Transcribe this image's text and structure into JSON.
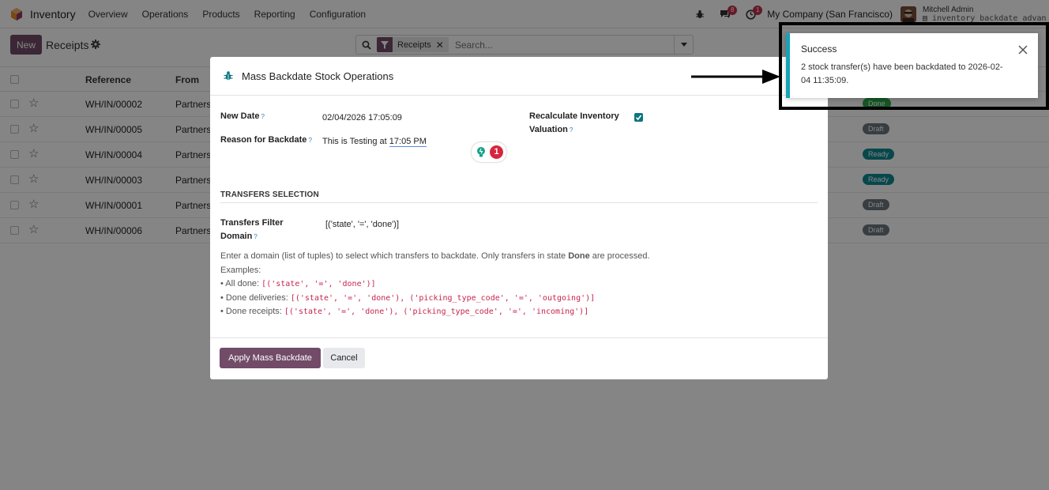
{
  "navbar": {
    "app_name": "Inventory",
    "menu": [
      "Overview",
      "Operations",
      "Products",
      "Reporting",
      "Configuration"
    ],
    "messages_count": "8",
    "activities_count": "1",
    "company": "My Company (San Francisco)",
    "user_name": "Mitchell Admin",
    "database": "inventory_backdate_advan"
  },
  "control": {
    "new_label": "New",
    "page_title": "Receipts",
    "facet_label": "Receipts",
    "facet_remove": "✕",
    "search_placeholder": "Search..."
  },
  "list": {
    "columns": [
      "Reference",
      "From"
    ],
    "rows": [
      {
        "reference": "WH/IN/00002",
        "from": "Partners",
        "status": "Done"
      },
      {
        "reference": "WH/IN/00005",
        "from": "Partners",
        "status": "Draft"
      },
      {
        "reference": "WH/IN/00004",
        "from": "Partners",
        "status": "Ready"
      },
      {
        "reference": "WH/IN/00003",
        "from": "Partners",
        "status": "Ready"
      },
      {
        "reference": "WH/IN/00001",
        "from": "Partners",
        "status": "Draft"
      },
      {
        "reference": "WH/IN/00006",
        "from": "Partners",
        "status": "Draft"
      }
    ]
  },
  "modal": {
    "title": "Mass Backdate Stock Operations",
    "new_date_label": "New Date",
    "new_date_value": "02/04/2026 17:05:09",
    "reason_label": "Reason for Backdate",
    "reason_text": "This is Testing at ",
    "reason_time": "17:05 PM",
    "recalc_label_1": "Recalculate Inventory",
    "recalc_label_2": "Valuation",
    "recalc_checked": true,
    "grammar_count": "1",
    "section_title": "TRANSFERS SELECTION",
    "filter_label_1": "Transfers Filter",
    "filter_label_2": "Domain",
    "filter_value": "[('state', '=', 'done')]",
    "help_text_1": "Enter a domain (list of tuples) to select which transfers to backdate. Only transfers in state ",
    "help_text_bold": "Done",
    "help_text_2": " are processed.",
    "examples_label": "Examples:",
    "ex1_label": "• All done: ",
    "ex1_code": "[('state', '=', 'done')]",
    "ex2_label": "• Done deliveries: ",
    "ex2_code": "[('state', '=', 'done'), ('picking_type_code', '=', 'outgoing')]",
    "ex3_label": "• Done receipts: ",
    "ex3_code": "[('state', '=', 'done'), ('picking_type_code', '=', 'incoming')]",
    "apply_label": "Apply Mass Backdate",
    "cancel_label": "Cancel",
    "help_mark": "?"
  },
  "notification": {
    "title": "Success",
    "message": "2 stock transfer(s) have been backdated to 2026-02-04 11:35:09."
  },
  "colors": {
    "brand": "#714b67",
    "toast_accent": "#17a2b8",
    "checkbox": "#0b7680",
    "done": "#28a745",
    "draft": "#6c757d",
    "ready": "#0f8a93"
  }
}
